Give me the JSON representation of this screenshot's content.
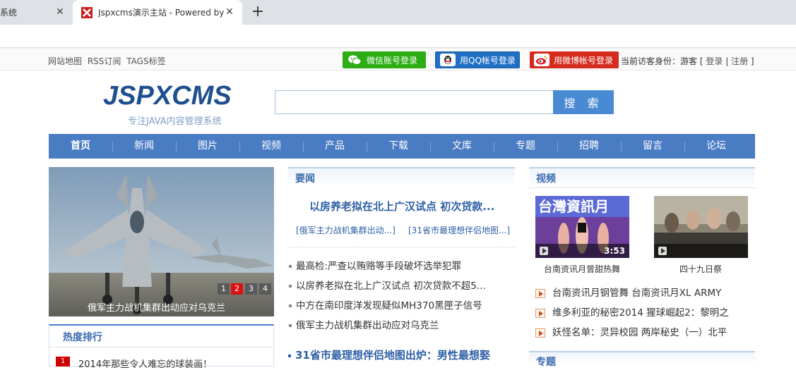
{
  "browser": {
    "tabs": [
      {
        "title": "系统"
      },
      {
        "title": "Jspxcms演示主站 - Powered by Jspxcms"
      }
    ],
    "close_glyph": "✕",
    "new_tab_glyph": "+"
  },
  "topbar": {
    "links": [
      "网站地图",
      "RSS订阅",
      "TAGS标签"
    ],
    "wechat_login": "微信账号登录",
    "qq_login": "用QQ帐号登录",
    "weibo_login": "用微博帐号登录",
    "visitor_label": "当前访客身份：游客",
    "bracket_open": "[",
    "login": "登录",
    "divider": "|",
    "register": "注册",
    "bracket_close": "]"
  },
  "header": {
    "logo": "JSPXCMS",
    "slogan": "专注JAVA内容管理系统",
    "search_placeholder": "",
    "search_button": "搜 索"
  },
  "nav": [
    "首页",
    "新闻",
    "图片",
    "视频",
    "产品",
    "下载",
    "文库",
    "专题",
    "招聘",
    "留言",
    "论坛"
  ],
  "slideshow": {
    "caption": "俄军主力战机集群出动应对乌克兰",
    "pages": [
      "1",
      "2",
      "3",
      "4"
    ],
    "current": "2"
  },
  "hot": {
    "title": "热度排行",
    "first_num": "1",
    "first_item": "2014年那些令人难忘的球装画！"
  },
  "news": {
    "title": "要闻",
    "headline": "以房养老拟在北上广汉试点 初次贷款...",
    "sub1": "[俄军主力战机集群出动...]",
    "sub2": "[31省市最理想伴侣地图...]",
    "items": [
      "最高检:严查以贿赂等手段破坏选举犯罪",
      "以房养老拟在北上广汉试点 初次贷款不超5...",
      "中方在南印度洋发现疑似MH370黑匣子信号",
      "俄军主力战机集群出动应对乌克兰"
    ],
    "bottom_headline": "31省市最理想伴侣地图出炉：男性最想娶"
  },
  "video": {
    "title": "视频",
    "thumb1_caption": "台南资讯月曾甜热舞",
    "thumb1_duration": "3:53",
    "thumb1_sign": "台灣資訊月",
    "thumb2_caption": "四十九日祭",
    "items": [
      "台南资讯月钢管舞  台南资讯月XL ARMY",
      "维多利亚的秘密2014  猩球崛起2：黎明之",
      "妖怪名单：灵异校园  两岸秘史（一）北平"
    ]
  },
  "topic": {
    "title": "专题"
  },
  "colors": {
    "nav": "#4a7cc4",
    "accent_blue": "#2d5fa6",
    "wechat": "#2bad13",
    "weibo": "#d52b1e",
    "qq": "#1f6fc5"
  }
}
